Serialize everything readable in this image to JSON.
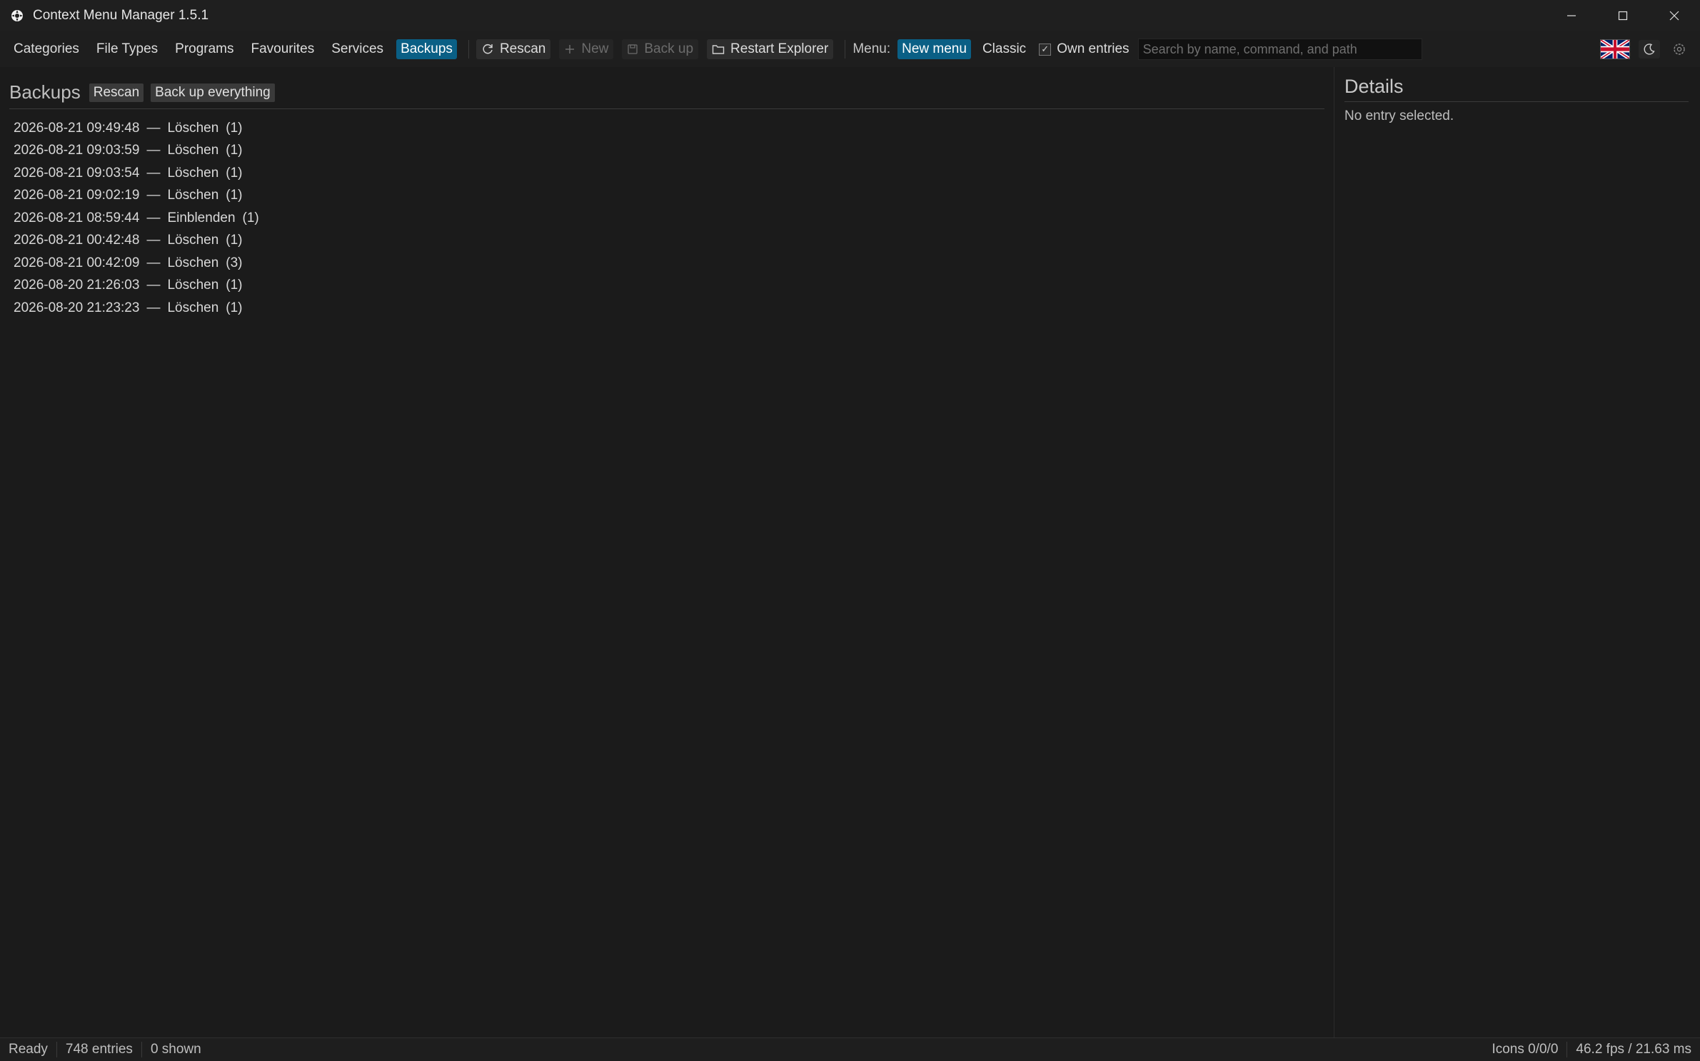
{
  "window": {
    "title": "Context Menu Manager 1.5.1",
    "app_icon": "gear-icon"
  },
  "toolbar": {
    "tabs": [
      "Categories",
      "File Types",
      "Programs",
      "Favourites",
      "Services",
      "Backups"
    ],
    "active_tab": "Backups",
    "rescan": "Rescan",
    "new": "New",
    "back_up": "Back up",
    "restart_explorer": "Restart Explorer",
    "menu_label": "Menu:",
    "new_menu": "New menu",
    "classic": "Classic",
    "own_entries": "Own entries",
    "own_entries_checked": true,
    "search_placeholder": "Search by name, command, and path"
  },
  "main": {
    "title": "Backups",
    "rescan_button": "Rescan",
    "backup_all_button": "Back up everything",
    "entries": [
      {
        "timestamp": "2026-08-21 09:49:48",
        "action": "Löschen",
        "count": "(1)"
      },
      {
        "timestamp": "2026-08-21 09:03:59",
        "action": "Löschen",
        "count": "(1)"
      },
      {
        "timestamp": "2026-08-21 09:03:54",
        "action": "Löschen",
        "count": "(1)"
      },
      {
        "timestamp": "2026-08-21 09:02:19",
        "action": "Löschen",
        "count": "(1)"
      },
      {
        "timestamp": "2026-08-21 08:59:44",
        "action": "Einblenden",
        "count": "(1)"
      },
      {
        "timestamp": "2026-08-21 00:42:48",
        "action": "Löschen",
        "count": "(1)"
      },
      {
        "timestamp": "2026-08-21 00:42:09",
        "action": "Löschen",
        "count": "(3)"
      },
      {
        "timestamp": "2026-08-20 21:26:03",
        "action": "Löschen",
        "count": "(1)"
      },
      {
        "timestamp": "2026-08-20 21:23:23",
        "action": "Löschen",
        "count": "(1)"
      }
    ],
    "separator": "—"
  },
  "details": {
    "title": "Details",
    "empty_text": "No entry selected."
  },
  "status": {
    "state": "Ready",
    "entries": "748 entries",
    "shown": "0 shown",
    "icons": "Icons 0/0/0",
    "perf": "46.2 fps / 21.63 ms"
  },
  "colors": {
    "accent": "#0a5f85",
    "background": "#1b1b1b"
  }
}
